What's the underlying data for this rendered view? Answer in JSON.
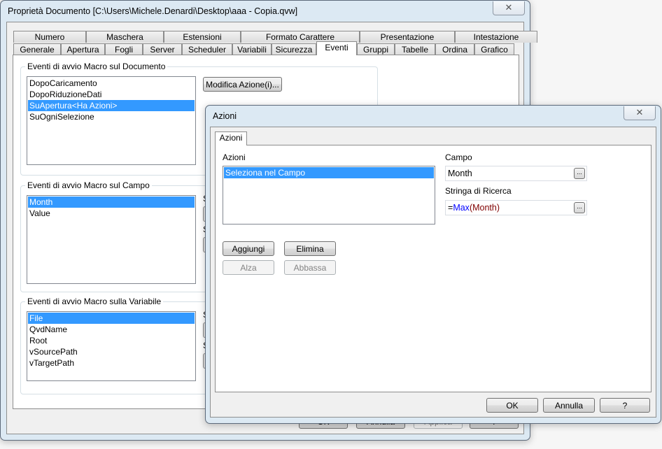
{
  "main_window": {
    "title": "Proprietà Documento [C:\\Users\\Michele.Denardi\\Desktop\\aaa - Copia.qvw]",
    "close_glyph": "✕",
    "tabs_row1": [
      "Numero",
      "Maschera",
      "Estensioni",
      "Formato Carattere",
      "Presentazione",
      "Intestazione"
    ],
    "tabs_row2": [
      "Generale",
      "Apertura",
      "Fogli",
      "Server",
      "Scheduler",
      "Variabili",
      "Sicurezza",
      "Eventi",
      "Gruppi",
      "Tabelle",
      "Ordina",
      "Grafico"
    ],
    "active_tab": "Eventi",
    "document_group": {
      "label": "Eventi di avvio Macro sul Documento",
      "items": [
        "DopoCaricamento",
        "DopoRiduzioneDati",
        "SuApertura<Ha Azioni>",
        "SuOgniSelezione"
      ],
      "selected": "SuApertura<Ha Azioni>",
      "edit_button": "Modifica Azione(i)..."
    },
    "field_group": {
      "label": "Eventi di avvio Macro sul Campo",
      "items": [
        "Month",
        "Value"
      ],
      "selected": "Month",
      "partial_labels": [
        "S",
        "S"
      ]
    },
    "variable_group": {
      "label": "Eventi di avvio Macro sulla Variabile",
      "items": [
        "File",
        "QvdName",
        "Root",
        "vSourcePath",
        "vTargetPath"
      ],
      "selected": "File",
      "partial_labels": [
        "S",
        "S"
      ]
    },
    "footer_buttons": [
      "OK",
      "Annulla",
      "Applica",
      "?"
    ]
  },
  "actions_dialog": {
    "title": "Azioni",
    "close_glyph": "✕",
    "tab": "Azioni",
    "actions_label": "Azioni",
    "actions_list": [
      "Seleziona nel Campo"
    ],
    "selected_action": "Seleziona nel Campo",
    "field_label": "Campo",
    "field_value": "Month",
    "search_label": "Stringa di Ricerca",
    "search_value": {
      "eq": "=",
      "func": "Max",
      "open": "(",
      "arg": "Month",
      "close": ")"
    },
    "search_colors": {
      "func": "#0000ff",
      "arg": "#800000"
    },
    "browse_glyph": "...",
    "buttons": {
      "add": "Aggiungi",
      "delete": "Elimina",
      "up": "Alza",
      "down": "Abbassa"
    },
    "footer_buttons": {
      "ok": "OK",
      "cancel": "Annulla",
      "help": "?"
    }
  }
}
